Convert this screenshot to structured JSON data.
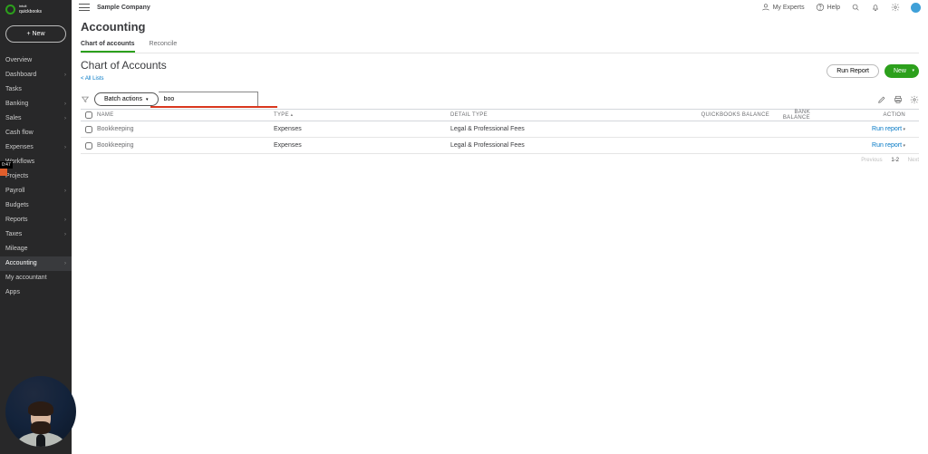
{
  "brand": {
    "top": "intuit",
    "bottom": "quickbooks"
  },
  "new_button": "+  New",
  "sidebar_items": [
    {
      "label": "Overview",
      "sub": false
    },
    {
      "label": "Dashboard",
      "sub": true
    },
    {
      "label": "Tasks",
      "sub": false
    },
    {
      "label": "Banking",
      "sub": true
    },
    {
      "label": "Sales",
      "sub": true
    },
    {
      "label": "Cash flow",
      "sub": false
    },
    {
      "label": "Expenses",
      "sub": true
    },
    {
      "label": "Workflows",
      "sub": false
    },
    {
      "label": "Projects",
      "sub": false
    },
    {
      "label": "Payroll",
      "sub": true
    },
    {
      "label": "Budgets",
      "sub": false
    },
    {
      "label": "Reports",
      "sub": true
    },
    {
      "label": "Taxes",
      "sub": true
    },
    {
      "label": "Mileage",
      "sub": false
    },
    {
      "label": "Accounting",
      "sub": true,
      "active": true
    },
    {
      "label": "My accountant",
      "sub": false
    },
    {
      "label": "Apps",
      "sub": false
    }
  ],
  "video_time": "0:47",
  "appbar": {
    "company": "Sample Company",
    "my_experts": "My Experts",
    "help": "Help"
  },
  "page_title": "Accounting",
  "tabs": [
    {
      "label": "Chart of accounts",
      "active": true
    },
    {
      "label": "Reconcile"
    }
  ],
  "section_title": "Chart of Accounts",
  "back_link": "< All Lists",
  "buttons": {
    "run_report": "Run Report",
    "new": "New",
    "batch": "Batch actions"
  },
  "search_placeholder": "boo",
  "columns": {
    "name": "NAME",
    "type": "TYPE",
    "detail": "DETAIL TYPE",
    "qbal": "QUICKBOOKS BALANCE",
    "bbal": "BANK BALANCE",
    "action": "ACTION"
  },
  "rows": [
    {
      "name": "Bookkeeping",
      "type": "Expenses",
      "detail": "Legal & Professional Fees",
      "qbal": "",
      "bbal": "",
      "action": "Run report"
    },
    {
      "name": "Bookkeeping",
      "type": "Expenses",
      "detail": "Legal & Professional Fees",
      "qbal": "",
      "bbal": "",
      "action": "Run report"
    }
  ],
  "pager": {
    "prev": "Previous",
    "range": "1-2",
    "next": "Next"
  }
}
